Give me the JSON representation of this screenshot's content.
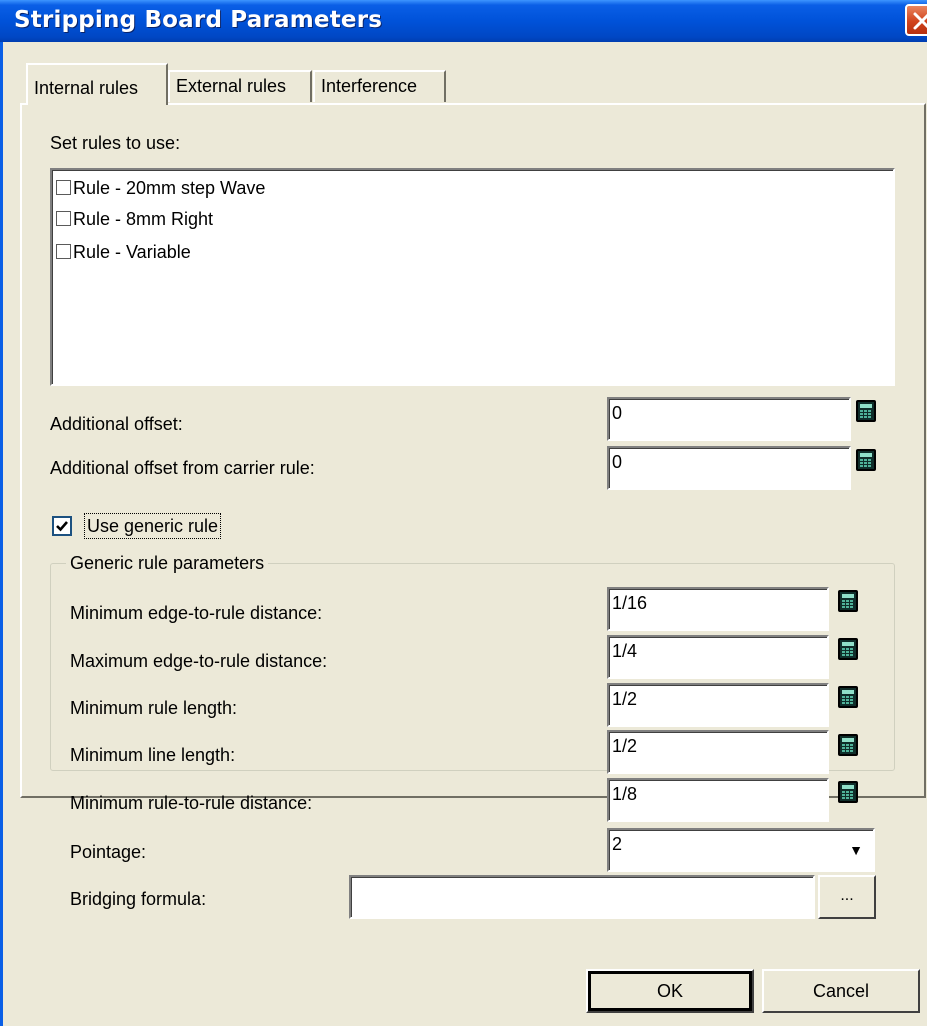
{
  "window": {
    "title": "Stripping Board Parameters"
  },
  "tabs": [
    {
      "label": "Internal rules",
      "active": true
    },
    {
      "label": "External rules",
      "active": false
    },
    {
      "label": "Interference",
      "active": false
    }
  ],
  "rules_section": {
    "label": "Set rules to use:",
    "items": [
      {
        "label": "Rule - 20mm step Wave",
        "checked": false
      },
      {
        "label": "Rule - 8mm Right",
        "checked": false
      },
      {
        "label": "Rule - Variable",
        "checked": false
      }
    ]
  },
  "offsets": {
    "additional_offset_label": "Additional offset:",
    "additional_offset_value": "0",
    "carrier_offset_label": "Additional offset from carrier rule:",
    "carrier_offset_value": "0"
  },
  "generic_rule": {
    "checkbox_label": "Use generic rule",
    "checked": true,
    "group_title": "Generic rule parameters",
    "min_edge_label": "Minimum edge-to-rule distance:",
    "min_edge_value": "1/16",
    "max_edge_label": "Maximum edge-to-rule distance:",
    "max_edge_value": "1/4",
    "min_rule_length_label": "Minimum rule length:",
    "min_rule_length_value": "1/2",
    "min_line_length_label": "Minimum line length:",
    "min_line_length_value": "1/2",
    "min_rule_to_rule_label": "Minimum rule-to-rule distance:",
    "min_rule_to_rule_value": "1/8",
    "pointage_label": "Pointage:",
    "pointage_value": "2",
    "bridging_label": "Bridging formula:",
    "bridging_value": "",
    "browse_label": "..."
  },
  "buttons": {
    "ok": "OK",
    "cancel": "Cancel"
  },
  "icons": {
    "calculator": "calculator-icon",
    "close": "close-icon",
    "dropdown": "chevron-down-icon"
  },
  "colors": {
    "titlebar": "#0052d9",
    "face": "#ece9d8",
    "close": "#d1441d"
  }
}
